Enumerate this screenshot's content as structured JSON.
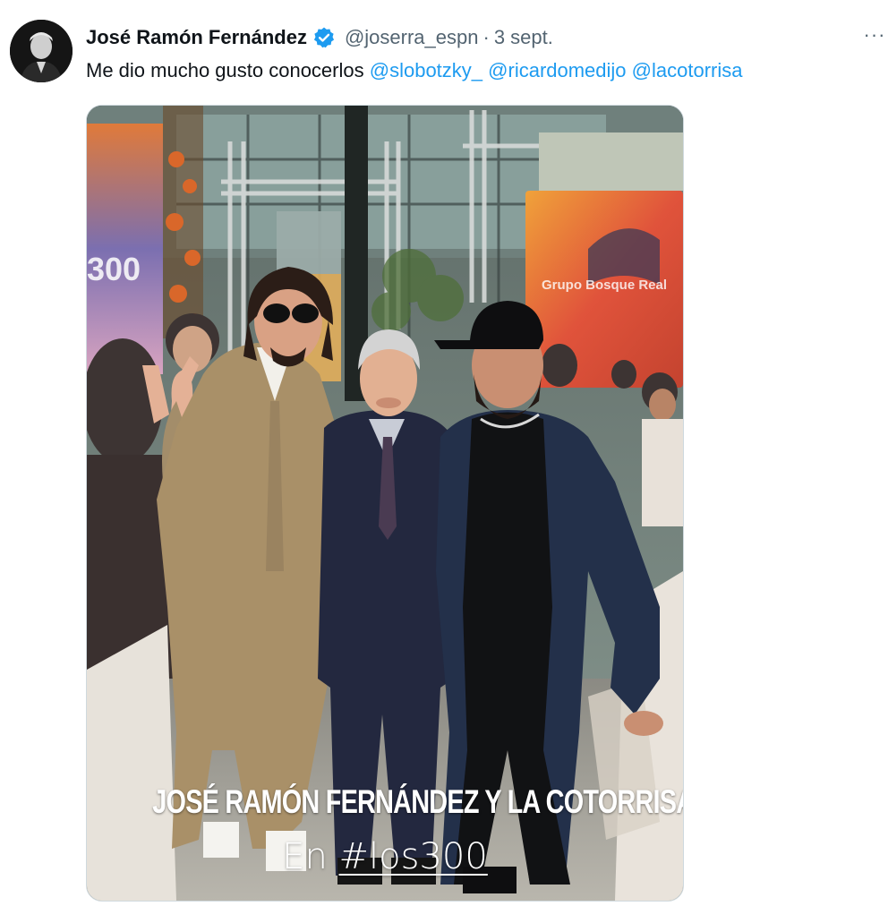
{
  "user": {
    "display_name": "José Ramón Fernández",
    "handle": "@joserra_espn",
    "separator": "·",
    "time": "3 sept.",
    "verified_icon": "verified-badge-icon"
  },
  "more_label": "···",
  "tweet": {
    "text": "Me dio mucho gusto conocerlos",
    "mentions": [
      "@slobotzky_",
      "@ricardomedijo",
      "@lacotorrisa"
    ]
  },
  "media": {
    "caption_line1": "JOSÉ RAMÓN FERNÁNDEZ Y LA COTORRISA",
    "caption_prefix": "En",
    "caption_hashtag": "#los300",
    "backdrop_logo": "300",
    "backdrop_brand": "Grupo Bosque Real"
  },
  "colors": {
    "link": "#1d9bf0",
    "verified": "#1d9bf0",
    "secondary_text": "#536471",
    "primary_text": "#0f1419"
  }
}
